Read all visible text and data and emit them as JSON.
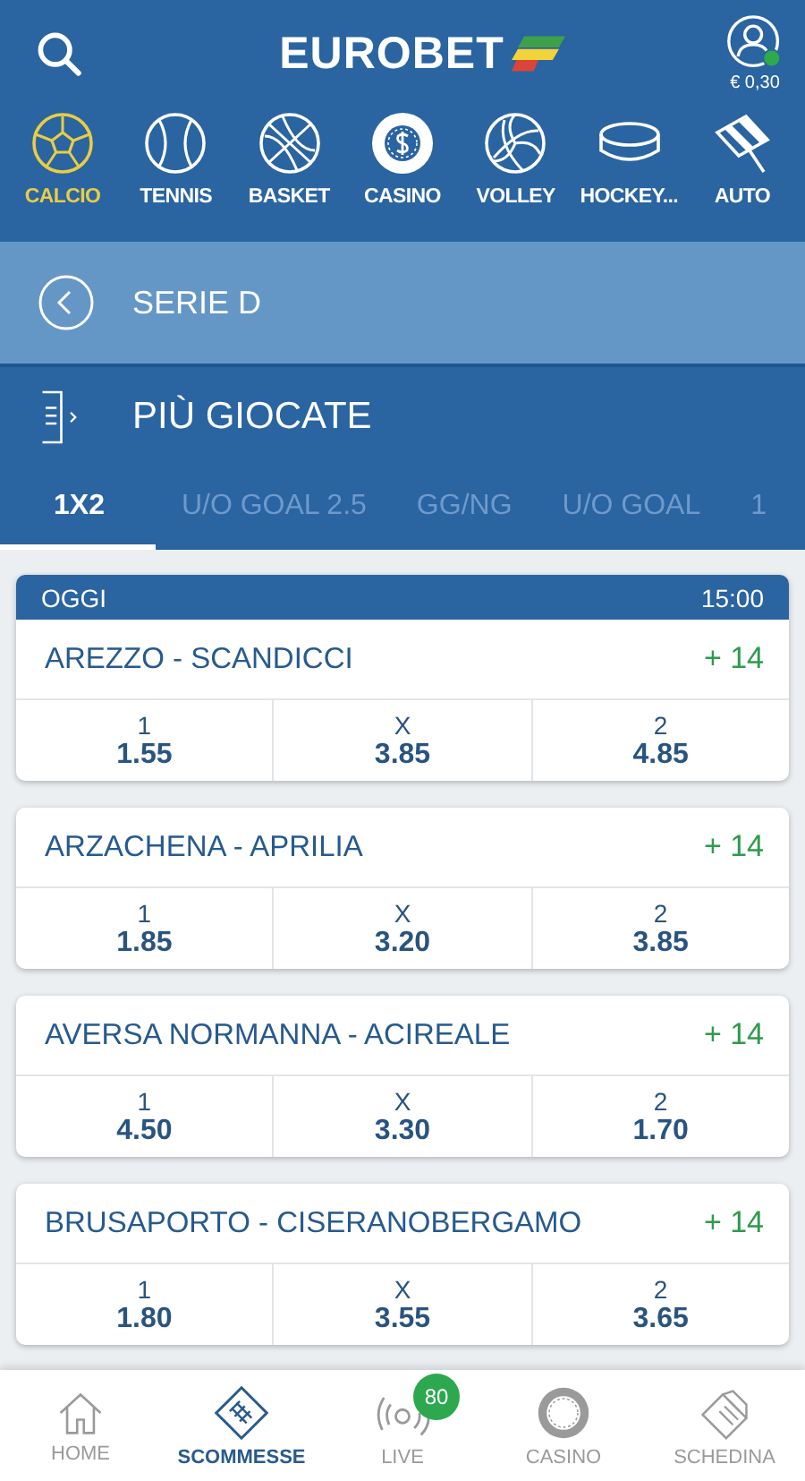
{
  "header": {
    "logo": "EUROBET",
    "balance": "€ 0,30",
    "online": true
  },
  "sports": [
    {
      "kind": "calcio",
      "label": "CALCIO",
      "selected": true
    },
    {
      "kind": "tennis",
      "label": "TENNIS",
      "selected": false
    },
    {
      "kind": "basket",
      "label": "BASKET",
      "selected": false
    },
    {
      "kind": "casino",
      "label": "CASINO",
      "selected": false
    },
    {
      "kind": "volley",
      "label": "VOLLEY",
      "selected": false
    },
    {
      "kind": "hockey",
      "label": "HOCKEY...",
      "selected": false
    },
    {
      "kind": "auto",
      "label": "AUTO",
      "selected": false
    }
  ],
  "league": {
    "title": "SERIE D"
  },
  "section": {
    "title": "PIÙ GIOCATE"
  },
  "market_tabs": [
    {
      "label": "1X2",
      "selected": true
    },
    {
      "label": "U/O GOAL 2.5",
      "selected": false
    },
    {
      "label": "GG/NG",
      "selected": false
    },
    {
      "label": "U/O GOAL",
      "selected": false
    },
    {
      "label": "1",
      "selected": false
    }
  ],
  "date_header": {
    "day": "OGGI",
    "time": "15:00"
  },
  "matches": [
    {
      "name": "AREZZO - SCANDICCI",
      "more": "+ 14",
      "odds": [
        {
          "label": "1",
          "value": "1.55"
        },
        {
          "label": "X",
          "value": "3.85"
        },
        {
          "label": "2",
          "value": "4.85"
        }
      ]
    },
    {
      "name": "ARZACHENA - APRILIA",
      "more": "+ 14",
      "odds": [
        {
          "label": "1",
          "value": "1.85"
        },
        {
          "label": "X",
          "value": "3.20"
        },
        {
          "label": "2",
          "value": "3.85"
        }
      ]
    },
    {
      "name": "AVERSA NORMANNA - ACIREALE",
      "more": "+ 14",
      "odds": [
        {
          "label": "1",
          "value": "4.50"
        },
        {
          "label": "X",
          "value": "3.30"
        },
        {
          "label": "2",
          "value": "1.70"
        }
      ]
    },
    {
      "name": "BRUSAPORTO - CISERANOBERGAMO",
      "more": "+ 14",
      "odds": [
        {
          "label": "1",
          "value": "1.80"
        },
        {
          "label": "X",
          "value": "3.55"
        },
        {
          "label": "2",
          "value": "3.65"
        }
      ]
    }
  ],
  "bottom_nav": [
    {
      "kind": "home",
      "label": "HOME",
      "selected": false
    },
    {
      "kind": "scommesse",
      "label": "SCOMMESSE",
      "selected": true
    },
    {
      "kind": "live",
      "label": "LIVE",
      "selected": false,
      "badge": "80"
    },
    {
      "kind": "casino",
      "label": "CASINO",
      "selected": false
    },
    {
      "kind": "schedina",
      "label": "SCHEDINA",
      "selected": false
    }
  ]
}
